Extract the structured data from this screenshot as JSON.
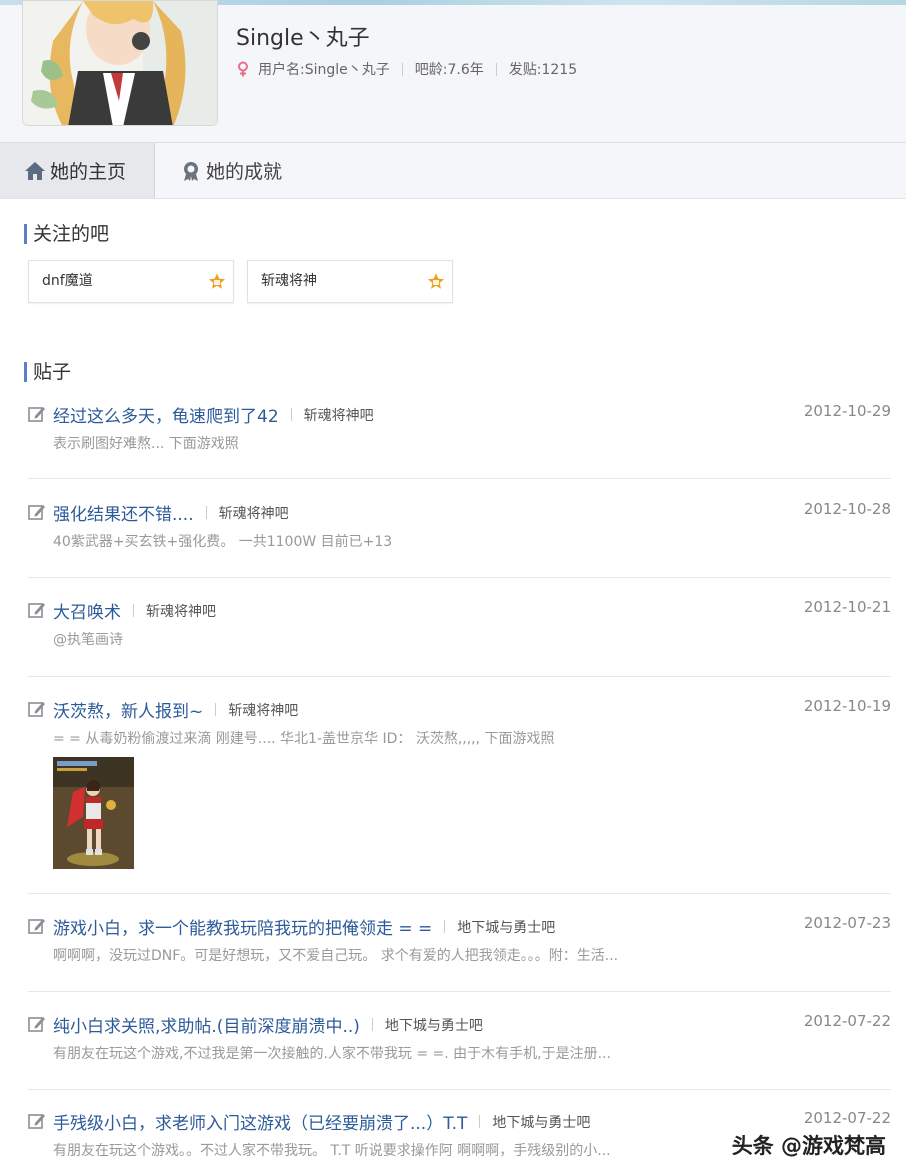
{
  "profile": {
    "name": "Single丶丸子",
    "username_label": "用户名:Single丶丸子",
    "age_label": "吧龄:7.6年",
    "posts_label": "发贴:1215"
  },
  "tabs": [
    {
      "label": "她的主页",
      "icon": "home-icon"
    },
    {
      "label": "她的成就",
      "icon": "medal-icon"
    }
  ],
  "sections": {
    "followed_title": "关注的吧",
    "posts_title": "贴子"
  },
  "followed_bars": [
    {
      "name": "dnf魔道",
      "badge": "level-badge-icon"
    },
    {
      "name": "斩魂将神",
      "badge": "level-badge-icon"
    }
  ],
  "posts": [
    {
      "title": "经过这么多天，龟速爬到了42",
      "forum": "斩魂将神吧",
      "date": "2012-10-29",
      "excerpt": "表示刷图好难熬... 下面游戏照"
    },
    {
      "title": "强化结果还不错....",
      "forum": "斩魂将神吧",
      "date": "2012-10-28",
      "excerpt": "40紫武器+买玄铁+强化费。 一共1100W 目前已+13"
    },
    {
      "title": "大召唤术",
      "forum": "斩魂将神吧",
      "date": "2012-10-21",
      "excerpt": "@执笔画诗"
    },
    {
      "title": "沃茨熬，新人报到~",
      "forum": "斩魂将神吧",
      "date": "2012-10-19",
      "excerpt": "= = 从毒奶粉偷渡过来滴 刚建号.... 华北1-盖世京华 ID： 沃茨熬,,,,, 下面游戏照"
    },
    {
      "title": "游戏小白，求一个能教我玩陪我玩的把俺领走 = =",
      "forum": "地下城与勇士吧",
      "date": "2012-07-23",
      "excerpt": "啊啊啊，没玩过DNF。可是好想玩，又不爱自己玩。 求个有爱的人把我领走。。。附：生活..."
    },
    {
      "title": "纯小白求关照,求助帖.(目前深度崩溃中..)",
      "forum": "地下城与勇士吧",
      "date": "2012-07-22",
      "excerpt": "有朋友在玩这个游戏,不过我是第一次接触的.人家不带我玩 = =. 由于木有手机,于是注册..."
    },
    {
      "title": "手残级小白，求老师入门这游戏（已经要崩溃了...）T.T",
      "forum": "地下城与勇士吧",
      "date": "2012-07-22",
      "excerpt": "有朋友在玩这个游戏。。不过人家不带我玩。 T.T 听说要求操作阿 啊啊啊，手残级别的小..."
    }
  ],
  "watermark": "头条 @游戏梵高",
  "colors": {
    "accent": "#5a7fc4",
    "link": "#2d5b9a",
    "female": "#e8708a",
    "badge": "#f0a020"
  }
}
